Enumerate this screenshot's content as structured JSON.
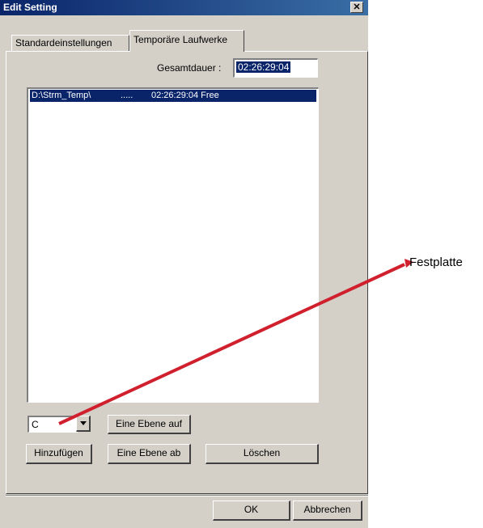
{
  "window": {
    "title": "Edit Setting",
    "close_glyph": "✕"
  },
  "tabs": [
    {
      "label": "Standardeinstellungen",
      "active": false
    },
    {
      "label": "Temporäre Laufwerke",
      "active": true
    }
  ],
  "gesamtdauer": {
    "label": "Gesamtdauer :",
    "value": "02:26:29:04"
  },
  "drive_list": {
    "rows": [
      {
        "path": "D:\\Strm_Temp\\",
        "dots": ".....",
        "info": "02:26:29:04 Free",
        "selected": true
      }
    ]
  },
  "drive_combo": {
    "value": "C"
  },
  "buttons": {
    "up_level": "Eine Ebene auf",
    "add": "Hinzufügen",
    "down_level": "Eine Ebene ab",
    "delete": "Löschen",
    "ok": "OK",
    "cancel": "Abbrechen"
  },
  "annotation": {
    "label": "Festplatte",
    "line_color": "#d0202e"
  },
  "colors": {
    "dialog_bg": "#d4d0c8",
    "selection": "#0a246a",
    "title_gradient_start": "#0a246a",
    "title_gradient_end": "#3a6ea5"
  }
}
